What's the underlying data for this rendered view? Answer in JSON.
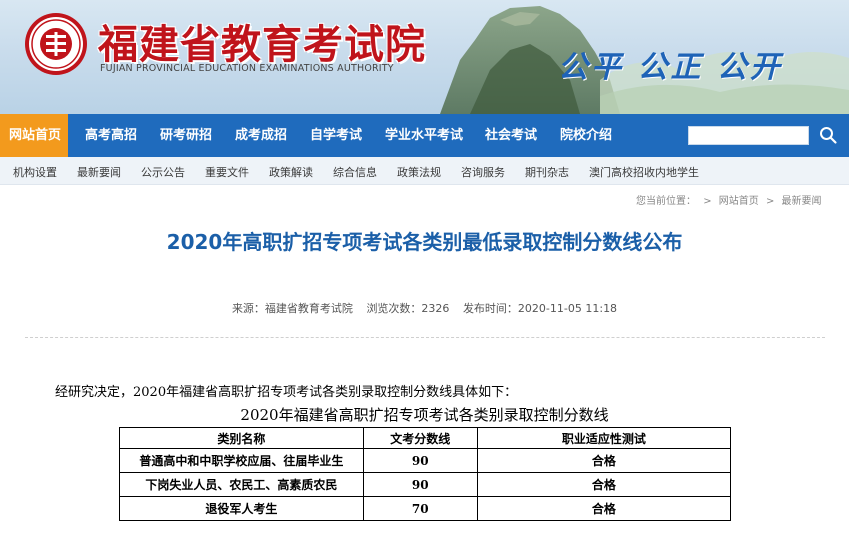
{
  "header": {
    "title": "福建省教育考试院",
    "subtitle": "FUJIAN PROVINCIAL EDUCATION EXAMINATIONS AUTHORITY",
    "slogan": "公平 公正 公开"
  },
  "colors": {
    "brand_red": "#c0141b",
    "nav_blue": "#1f6bbd",
    "active_orange": "#f39a1d",
    "title_blue": "#1b5fa8",
    "slogan_blue": "#1e63b7"
  },
  "main_nav": {
    "items": [
      {
        "label": "网站首页",
        "active": true
      },
      {
        "label": "高考高招",
        "active": false
      },
      {
        "label": "研考研招",
        "active": false
      },
      {
        "label": "成考成招",
        "active": false
      },
      {
        "label": "自学考试",
        "active": false
      },
      {
        "label": "学业水平考试",
        "active": false
      },
      {
        "label": "社会考试",
        "active": false
      },
      {
        "label": "院校介绍",
        "active": false
      }
    ],
    "search_value": "",
    "search_icon": "search-icon"
  },
  "sub_nav": {
    "items": [
      {
        "label": "机构设置"
      },
      {
        "label": "最新要闻"
      },
      {
        "label": "公示公告"
      },
      {
        "label": "重要文件"
      },
      {
        "label": "政策解读"
      },
      {
        "label": "综合信息"
      },
      {
        "label": "政策法规"
      },
      {
        "label": "咨询服务"
      },
      {
        "label": "期刊杂志"
      },
      {
        "label": "澳门高校招收内地学生"
      }
    ]
  },
  "breadcrumb": {
    "prefix": "您当前位置：",
    "items": [
      "网站首页",
      "最新要闻"
    ],
    "separator": ">"
  },
  "article": {
    "title": "2020年高职扩招专项考试各类别最低录取控制分数线公布",
    "meta": {
      "source": "来源：福建省教育考试院",
      "views": "浏览次数：2326",
      "published": "发布时间：2020-11-05 11:18"
    },
    "intro": "经研究决定，2020年福建省高职扩招专项考试各类别录取控制分数线具体如下：",
    "table_title": "2020年福建省高职扩招专项考试各类别录取控制分数线",
    "table": {
      "headers": [
        "类别名称",
        "文考分数线",
        "职业适应性测试"
      ],
      "rows": [
        [
          "普通高中和中职学校应届、往届毕业生",
          "90",
          "合格"
        ],
        [
          "下岗失业人员、农民工、高素质农民",
          "90",
          "合格"
        ],
        [
          "退役军人考生",
          "70",
          "合格"
        ]
      ]
    }
  }
}
